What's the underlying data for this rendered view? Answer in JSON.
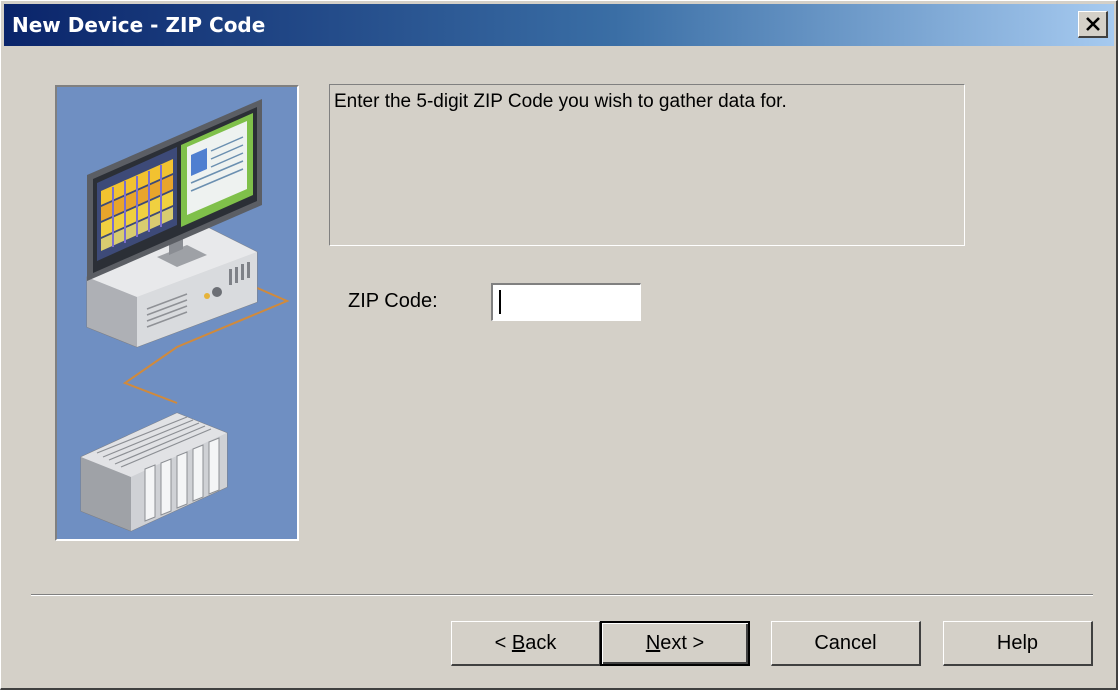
{
  "window": {
    "title": "New Device - ZIP Code",
    "close_symbol": "✕"
  },
  "description": {
    "text": "Enter the 5-digit ZIP Code you wish to gather data for."
  },
  "form": {
    "zip_label": "ZIP Code:",
    "zip_value": ""
  },
  "buttons": {
    "back": {
      "prefix": "< ",
      "mnemonic": "B",
      "rest": "ack"
    },
    "next": {
      "mnemonic": "N",
      "rest": "ext >"
    },
    "cancel": "Cancel",
    "help": "Help"
  },
  "illustration": {
    "icon": "computer-and-plc-illustration"
  },
  "colors": {
    "title_gradient_start": "#0a246a",
    "title_gradient_end": "#a6caf0",
    "face": "#d4d0c8",
    "illustration_bg": "#6f8fc2",
    "cable": "#d08a3c"
  }
}
